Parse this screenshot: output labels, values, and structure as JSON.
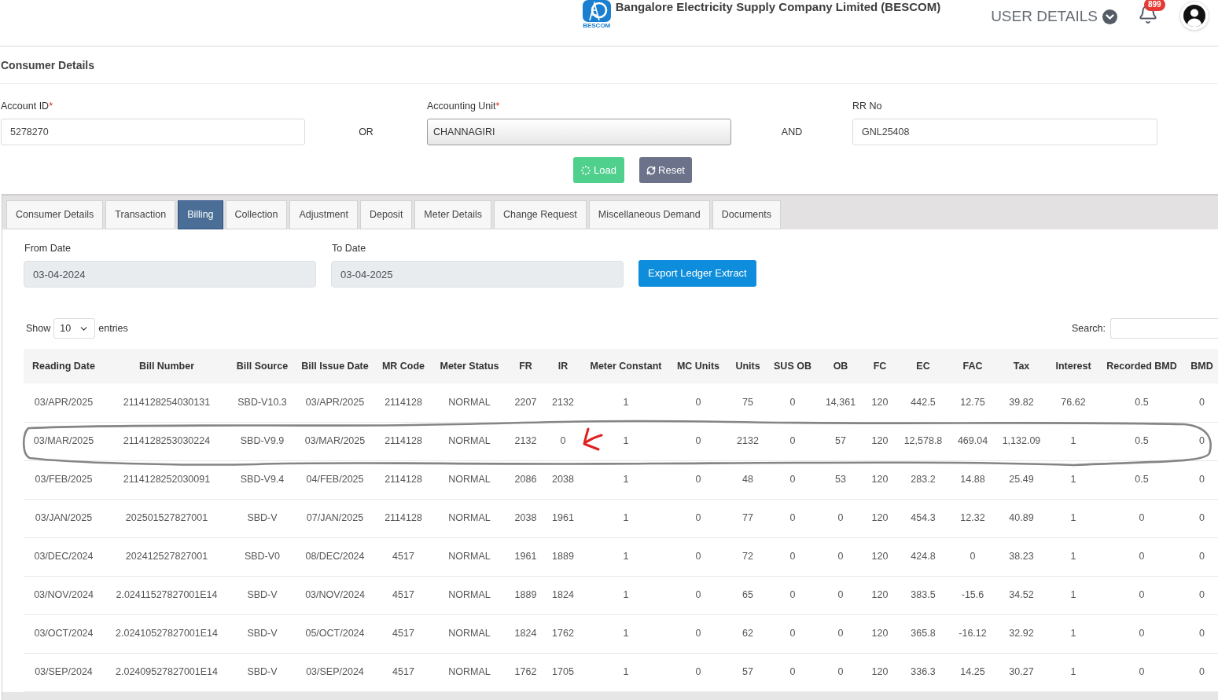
{
  "header": {
    "logo_caption": "BESCOM",
    "title": "Bangalore Electricity Supply Company Limited (BESCOM)",
    "user_menu": "USER DETAILS",
    "notification_count": "899"
  },
  "section_title": "Consumer Details",
  "search_form": {
    "fields": [
      {
        "label": "Account ID",
        "required_mark": "*",
        "kind": "text",
        "value": "5278270"
      },
      {
        "label": "Accounting Unit",
        "required_mark": "*",
        "kind": "select",
        "value": "CHANNAGIRI"
      },
      {
        "label": "RR No",
        "kind": "text",
        "value": "GNL25408"
      }
    ],
    "connectors": [
      "OR",
      "AND"
    ],
    "buttons": [
      {
        "label": "Load",
        "kind": "load"
      },
      {
        "label": "Reset",
        "kind": "reset"
      }
    ]
  },
  "tabs": [
    {
      "label": "Consumer Details",
      "selected": false
    },
    {
      "label": "Transaction",
      "selected": false
    },
    {
      "label": "Billing",
      "selected": true
    },
    {
      "label": "Collection",
      "selected": false
    },
    {
      "label": "Adjustment",
      "selected": false
    },
    {
      "label": "Deposit",
      "selected": false
    },
    {
      "label": "Meter Details",
      "selected": false
    },
    {
      "label": "Change Request",
      "selected": false
    },
    {
      "label": "Miscellaneous Demand",
      "selected": false
    },
    {
      "label": "Documents",
      "selected": false
    }
  ],
  "billing": {
    "date_fields": [
      {
        "label": "From Date",
        "value": "03-04-2024"
      },
      {
        "label": "To Date",
        "value": "03-04-2025"
      }
    ],
    "export_button": "Export Ledger Extract",
    "length_menu": {
      "show_label": "Show",
      "value": "10",
      "entries_label": "entries"
    },
    "search_label": "Search:",
    "table": {
      "columns": [
        "Reading Date",
        "Bill Number",
        "Bill Source",
        "Bill Issue Date",
        "MR Code",
        "Meter Status",
        "FR",
        "IR",
        "Meter Constant",
        "MC Units",
        "Units",
        "SUS OB",
        "OB",
        "FC",
        "EC",
        "FAC",
        "Tax",
        "Interest",
        "Recorded BMD",
        "BMD"
      ],
      "rows": [
        {
          "circled": false,
          "arrow": false,
          "cells": [
            "03/APR/2025",
            "2114128254030131",
            "SBD-V10.3",
            "03/APR/2025",
            "2114128",
            "NORMAL",
            "2207",
            "2132",
            "1",
            "0",
            "75",
            "0",
            "14,361",
            "120",
            "442.5",
            "12.75",
            "39.82",
            "76.62",
            "0.5",
            "0"
          ]
        },
        {
          "circled": true,
          "arrow": true,
          "cells": [
            "03/MAR/2025",
            "2114128253030224",
            "SBD-V9.9",
            "03/MAR/2025",
            "2114128",
            "NORMAL",
            "2132",
            "0",
            "1",
            "0",
            "2132",
            "0",
            "57",
            "120",
            "12,578.8",
            "469.04",
            "1,132.09",
            "1",
            "0.5",
            "0"
          ]
        },
        {
          "circled": false,
          "arrow": false,
          "cells": [
            "03/FEB/2025",
            "2114128252030091",
            "SBD-V9.4",
            "04/FEB/2025",
            "2114128",
            "NORMAL",
            "2086",
            "2038",
            "1",
            "0",
            "48",
            "0",
            "53",
            "120",
            "283.2",
            "14.88",
            "25.49",
            "1",
            "0.5",
            "0"
          ]
        },
        {
          "circled": false,
          "arrow": false,
          "cells": [
            "03/JAN/2025",
            "202501527827001",
            "SBD-V",
            "07/JAN/2025",
            "2114128",
            "NORMAL",
            "2038",
            "1961",
            "1",
            "0",
            "77",
            "0",
            "0",
            "120",
            "454.3",
            "12.32",
            "40.89",
            "1",
            "0",
            "0"
          ]
        },
        {
          "circled": false,
          "arrow": false,
          "cells": [
            "03/DEC/2024",
            "202412527827001",
            "SBD-V0",
            "08/DEC/2024",
            "4517",
            "NORMAL",
            "1961",
            "1889",
            "1",
            "0",
            "72",
            "0",
            "0",
            "120",
            "424.8",
            "0",
            "38.23",
            "1",
            "0",
            "0"
          ]
        },
        {
          "circled": false,
          "arrow": false,
          "cells": [
            "03/NOV/2024",
            "2.02411527827001E14",
            "SBD-V",
            "03/NOV/2024",
            "4517",
            "NORMAL",
            "1889",
            "1824",
            "1",
            "0",
            "65",
            "0",
            "0",
            "120",
            "383.5",
            "-15.6",
            "34.52",
            "1",
            "0",
            "0"
          ]
        },
        {
          "circled": false,
          "arrow": false,
          "cells": [
            "03/OCT/2024",
            "2.02410527827001E14",
            "SBD-V",
            "05/OCT/2024",
            "4517",
            "NORMAL",
            "1824",
            "1762",
            "1",
            "0",
            "62",
            "0",
            "0",
            "120",
            "365.8",
            "-16.12",
            "32.92",
            "1",
            "0",
            "0"
          ]
        },
        {
          "circled": false,
          "arrow": false,
          "cells": [
            "03/SEP/2024",
            "2.02409527827001E14",
            "SBD-V",
            "03/SEP/2024",
            "4517",
            "NORMAL",
            "1762",
            "1705",
            "1",
            "0",
            "57",
            "0",
            "0",
            "120",
            "336.3",
            "14.25",
            "30.27",
            "1",
            "0",
            "0"
          ]
        }
      ]
    }
  }
}
